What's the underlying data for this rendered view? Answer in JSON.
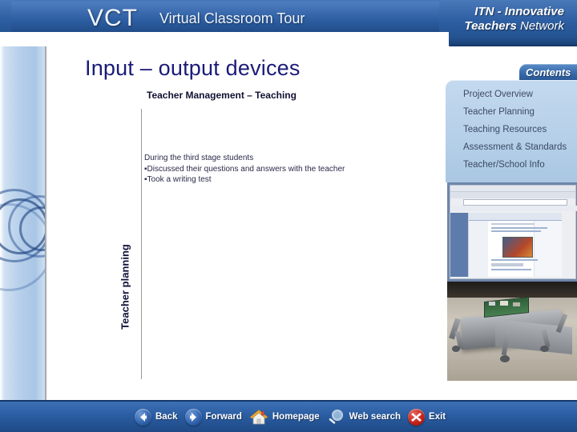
{
  "header": {
    "logo_main": "VCT",
    "logo_sub": "Virtual Classroom Tour",
    "brand_line1_bold": "ITN",
    "brand_line1_rest": " - Innovative",
    "brand_line2_bold": "Teachers",
    "brand_line2_rest": " Network"
  },
  "slide": {
    "title": "Input – output devices",
    "subtitle": "Teacher Management – Teaching",
    "vertical_axis_label": "Teacher planning",
    "body_lines": [
      "During the third stage students",
      "▪Discussed their questions and answers with the teacher",
      "▪Took a writing test"
    ]
  },
  "contents": {
    "tab_label": "Contents",
    "items": [
      {
        "label": "Project Overview"
      },
      {
        "label": "Teacher Planning"
      },
      {
        "label": "Teaching  Resources"
      },
      {
        "label": "Assessment & Standards"
      },
      {
        "label": "Teacher/School Info"
      }
    ]
  },
  "thumbnails": [
    {
      "name": "browser-screenshot-thumbnail",
      "alt": "Screenshot of a web browser showing a classroom web page"
    },
    {
      "name": "robot-photo-thumbnail",
      "alt": "Photograph of a metal robotic device on a table"
    }
  ],
  "bottom_nav": {
    "items": [
      {
        "label": "Back",
        "icon": "arrow-left-icon"
      },
      {
        "label": "Forward",
        "icon": "arrow-right-icon"
      },
      {
        "label": "Homepage",
        "icon": "house-icon"
      },
      {
        "label": "Web search",
        "icon": "magnifier-icon"
      },
      {
        "label": "Exit",
        "icon": "close-x-icon"
      }
    ]
  },
  "colors": {
    "header_blue": "#2d5ea2",
    "bar_blue": "#2b5ea4",
    "title_navy": "#1b1b78",
    "panel_blue": "#b6d0e9",
    "rail_blue": "#b6cfea",
    "exit_red": "#c21f16"
  }
}
